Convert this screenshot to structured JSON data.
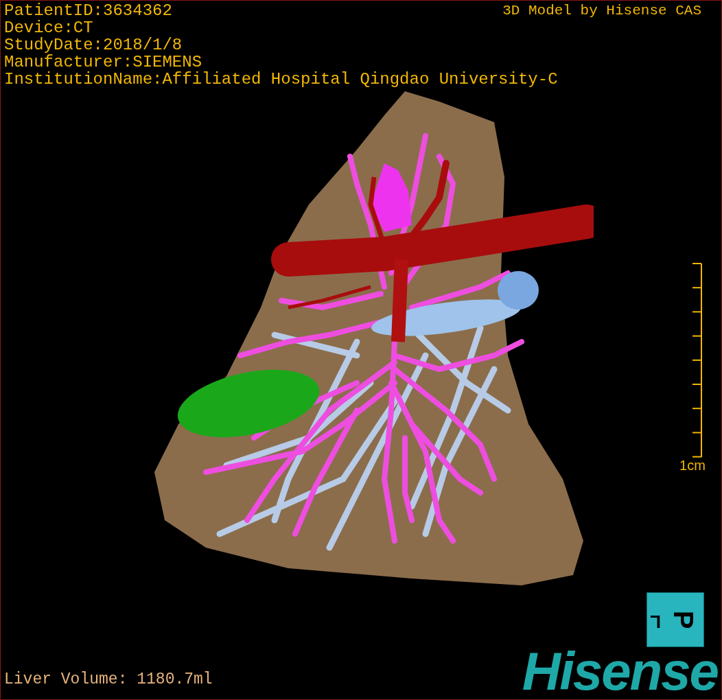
{
  "study_info": [
    "PatientID:3634362",
    "Device:CT",
    "StudyDate:2018/1/8",
    "Manufacturer:SIEMENS",
    "InstitutionName:Affiliated Hospital Qingdao University-C"
  ],
  "model_credit": "3D Model by Hisense CAS",
  "scale_bar": {
    "label": "1cm"
  },
  "liver_volume": "Liver Volume: 1180.7ml",
  "orientation_cube": {
    "side_face": "L",
    "front_face": "P"
  },
  "logo": "Hisense"
}
